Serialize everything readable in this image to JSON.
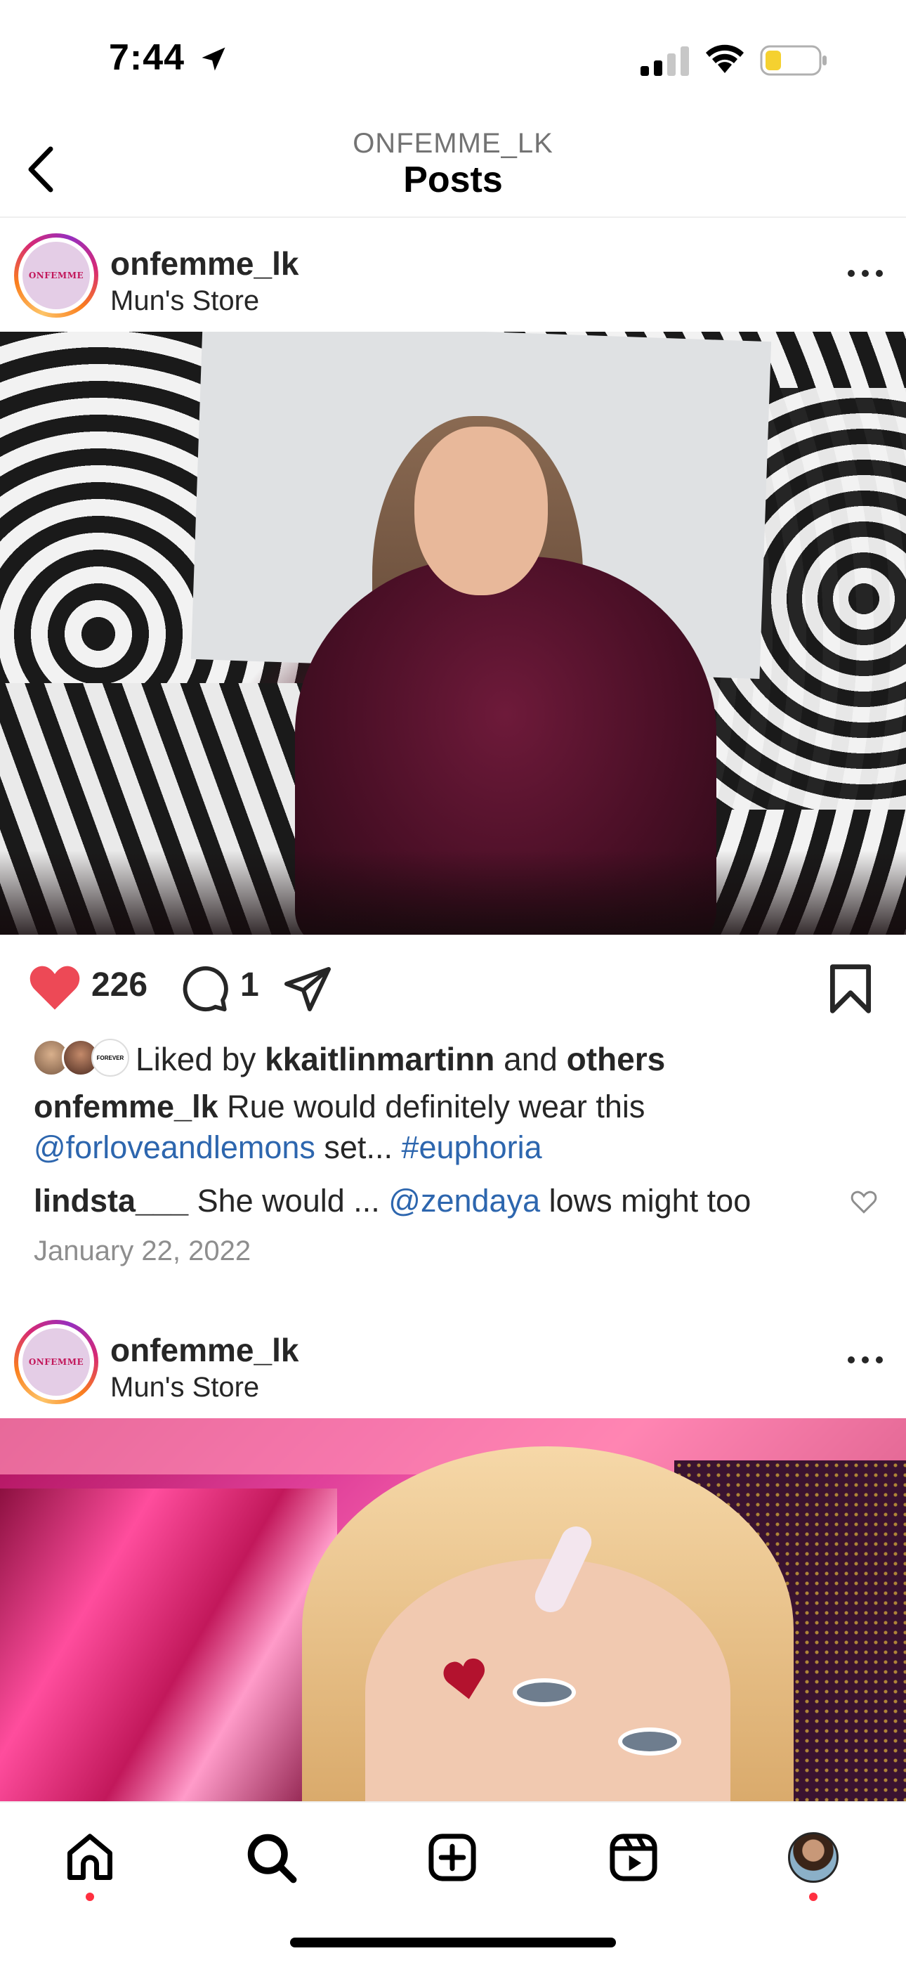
{
  "status_bar": {
    "time": "7:44"
  },
  "header": {
    "subtitle": "ONFEMME_LK",
    "title": "Posts"
  },
  "posts": [
    {
      "username": "onfemme_lk",
      "location": "Mun's Store",
      "avatar_logo": "ONFEMME",
      "likes": "226",
      "comments": "1",
      "liked_by_prefix": "Liked by ",
      "liked_by_user": "kkaitlinmartinn",
      "liked_by_and": " and ",
      "liked_by_others": "others",
      "caption_user": "onfemme_lk",
      "caption_text": " Rue would definitely wear this ",
      "caption_mention": "@forloveandlemons",
      "caption_mid": " set... ",
      "caption_hashtag": "#euphoria",
      "top_comment": {
        "user": "lindsta___",
        "text_before": " She would ... ",
        "mention": "@zendaya",
        "text_after": " lows might too"
      },
      "date": "January 22, 2022"
    },
    {
      "username": "onfemme_lk",
      "location": "Mun's Store",
      "avatar_logo": "ONFEMME"
    }
  ],
  "mini_avatar_3_text": "FOREVER",
  "colors": {
    "like_red": "#ed4956",
    "link_blue": "#2d66ae",
    "notification_dot": "#ff3040"
  },
  "tab_bar": {
    "tabs": [
      "home-icon",
      "search-icon",
      "create-icon",
      "reels-icon",
      "profile-avatar"
    ]
  }
}
